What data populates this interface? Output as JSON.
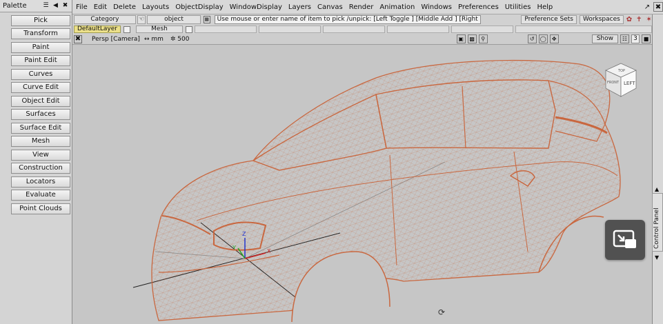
{
  "palette": {
    "title": "Palette",
    "items": [
      "Pick",
      "Transform",
      "Paint",
      "Paint Edit",
      "Curves",
      "Curve Edit",
      "Object Edit",
      "Surfaces",
      "Surface Edit",
      "Mesh",
      "View",
      "Construction",
      "Locators",
      "Evaluate",
      "Point Clouds"
    ]
  },
  "menubar": {
    "items": [
      "File",
      "Edit",
      "Delete",
      "Layouts",
      "ObjectDisplay",
      "WindowDisplay",
      "Layers",
      "Canvas",
      "Render",
      "Animation",
      "Windows",
      "Preferences",
      "Utilities",
      "Help"
    ]
  },
  "pickbar": {
    "category_label": "Category",
    "object_label": "object",
    "prompt": "Use mouse or enter name of item to pick /unpick: [Left Toggle ] [Middle Add ] [Right Unpick ]",
    "preference_sets_label": "Preference Sets",
    "workspaces_label": "Workspaces"
  },
  "layerbar": {
    "active_layer": "DefaultLayer",
    "layer2": "Mesh"
  },
  "viewport": {
    "camera_label": "Persp [Camera]",
    "units": "↔ mm",
    "scale_label": "✲ 500",
    "show_label": "Show",
    "window_number": "3",
    "viewcube_front": "FRONT",
    "viewcube_left": "LEFT",
    "viewcube_top": "TOP",
    "axis_x": "X",
    "axis_y": "Y",
    "axis_z": "Z"
  },
  "right_strip": {
    "control_panel_label": "Control Panel"
  },
  "colors": {
    "wireframe": "#c9673f",
    "active_layer": "#ece08a",
    "viewport_bg": "#c6c6c6",
    "pip_button": "#515151"
  }
}
